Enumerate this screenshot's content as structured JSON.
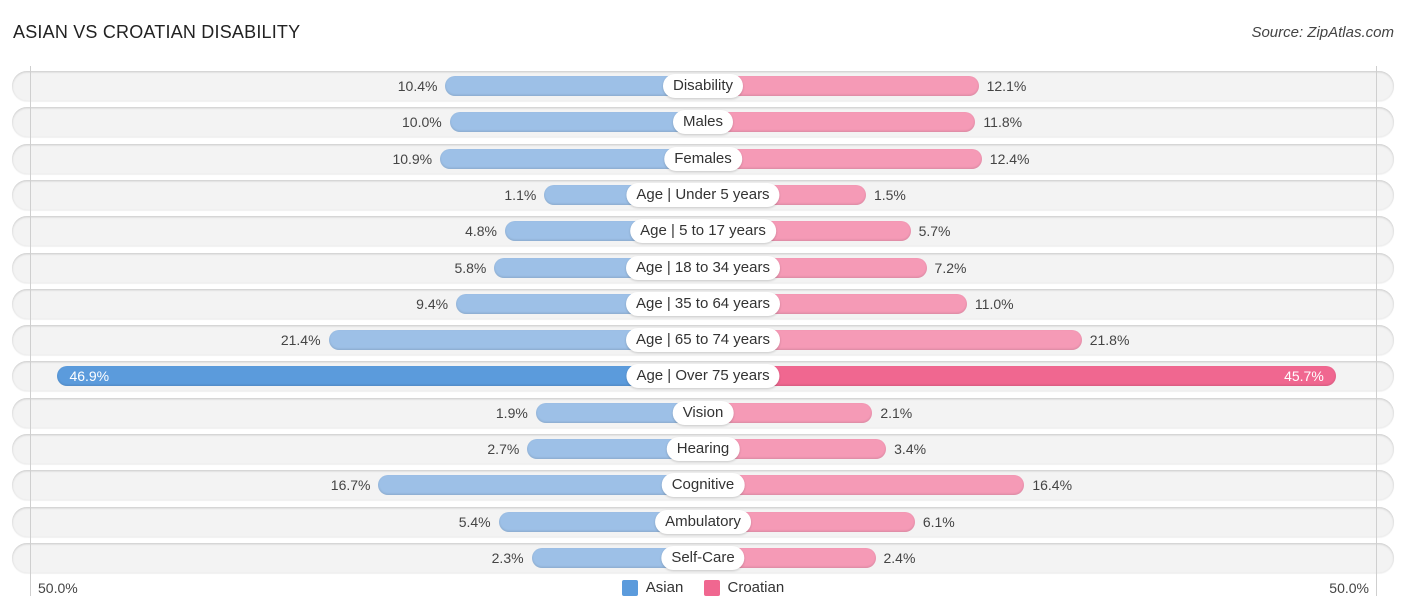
{
  "header": {
    "title": "ASIAN VS CROATIAN DISABILITY",
    "source": "Source: ZipAtlas.com"
  },
  "colors": {
    "asian": "#9dc0e7",
    "asian_highlight": "#5b9bdc",
    "croatian": "#f59ab6",
    "croatian_highlight": "#f06790"
  },
  "chart_data": {
    "type": "bar",
    "orientation": "horizontal-diverging",
    "title": "ASIAN VS CROATIAN DISABILITY",
    "xlabel": "",
    "ylabel": "",
    "axis_min_label": "50.0%",
    "axis_max_label": "50.0%",
    "xlim": [
      -50,
      50
    ],
    "legend_position": "bottom",
    "categories": [
      "Disability",
      "Males",
      "Females",
      "Age | Under 5 years",
      "Age | 5 to 17 years",
      "Age | 18 to 34 years",
      "Age | 35 to 64 years",
      "Age | 65 to 74 years",
      "Age | Over 75 years",
      "Vision",
      "Hearing",
      "Cognitive",
      "Ambulatory",
      "Self-Care"
    ],
    "series": [
      {
        "name": "Asian",
        "side": "left",
        "values": [
          10.4,
          10.0,
          10.9,
          1.1,
          4.8,
          5.8,
          9.4,
          21.4,
          46.9,
          1.9,
          2.7,
          16.7,
          5.4,
          2.3
        ],
        "labels": [
          "10.4%",
          "10.0%",
          "10.9%",
          "1.1%",
          "4.8%",
          "5.8%",
          "9.4%",
          "21.4%",
          "46.9%",
          "1.9%",
          "2.7%",
          "16.7%",
          "5.4%",
          "2.3%"
        ]
      },
      {
        "name": "Croatian",
        "side": "right",
        "values": [
          12.1,
          11.8,
          12.4,
          1.5,
          5.7,
          7.2,
          11.0,
          21.8,
          45.7,
          2.1,
          3.4,
          16.4,
          6.1,
          2.4
        ],
        "labels": [
          "12.1%",
          "11.8%",
          "12.4%",
          "1.5%",
          "5.7%",
          "7.2%",
          "11.0%",
          "21.8%",
          "45.7%",
          "2.1%",
          "3.4%",
          "16.4%",
          "6.1%",
          "2.4%"
        ]
      }
    ],
    "highlighted_category": "Age | Over 75 years"
  },
  "legend": {
    "items": [
      {
        "label": "Asian"
      },
      {
        "label": "Croatian"
      }
    ]
  }
}
